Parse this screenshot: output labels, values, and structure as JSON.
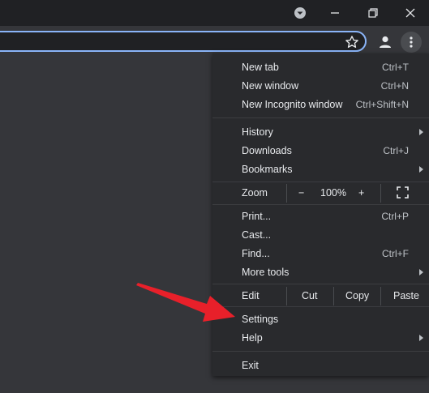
{
  "menu": {
    "new_tab": {
      "label": "New tab",
      "shortcut": "Ctrl+T"
    },
    "new_window": {
      "label": "New window",
      "shortcut": "Ctrl+N"
    },
    "new_incognito": {
      "label": "New Incognito window",
      "shortcut": "Ctrl+Shift+N"
    },
    "history": {
      "label": "History"
    },
    "downloads": {
      "label": "Downloads",
      "shortcut": "Ctrl+J"
    },
    "bookmarks": {
      "label": "Bookmarks"
    },
    "zoom": {
      "label": "Zoom",
      "minus": "−",
      "value": "100%",
      "plus": "+"
    },
    "print": {
      "label": "Print...",
      "shortcut": "Ctrl+P"
    },
    "cast": {
      "label": "Cast..."
    },
    "find": {
      "label": "Find...",
      "shortcut": "Ctrl+F"
    },
    "more_tools": {
      "label": "More tools"
    },
    "edit": {
      "label": "Edit",
      "cut": "Cut",
      "copy": "Copy",
      "paste": "Paste"
    },
    "settings": {
      "label": "Settings"
    },
    "help": {
      "label": "Help"
    },
    "exit": {
      "label": "Exit"
    }
  },
  "icons": {
    "tab_search": "tab-search-icon",
    "minimize": "minimize-icon",
    "restore": "restore-icon",
    "close": "close-icon",
    "bookmark_star": "star-icon",
    "profile": "profile-icon",
    "menu": "kebab-menu-icon",
    "fullscreen": "fullscreen-icon"
  },
  "colors": {
    "titlebar": "#202124",
    "toolbar": "#35363a",
    "menu_bg": "#292a2d",
    "accent": "#8ab4f8",
    "annotation_arrow": "#e8202a"
  }
}
